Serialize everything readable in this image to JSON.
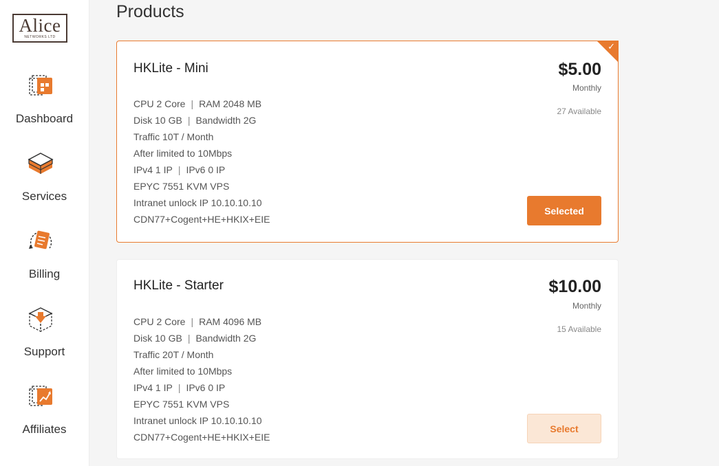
{
  "logo": {
    "name": "Alice",
    "subtitle": "NETWORKS LTD"
  },
  "nav": [
    {
      "label": "Dashboard",
      "icon": "dashboard-icon"
    },
    {
      "label": "Services",
      "icon": "services-icon"
    },
    {
      "label": "Billing",
      "icon": "billing-icon"
    },
    {
      "label": "Support",
      "icon": "support-icon"
    },
    {
      "label": "Affiliates",
      "icon": "affiliates-icon"
    }
  ],
  "page": {
    "title": "Products"
  },
  "products": [
    {
      "name": "HKLite - Mini",
      "price": "$5.00",
      "period": "Monthly",
      "available": "27 Available",
      "button": "Selected",
      "selected": true,
      "specs": [
        [
          "CPU 2 Core",
          "RAM 2048 MB"
        ],
        [
          "Disk 10 GB",
          "Bandwidth 2G"
        ],
        [
          "Traffic 10T / Month"
        ],
        [
          "After limited to 10Mbps"
        ],
        [
          "IPv4 1 IP",
          "IPv6 0 IP"
        ],
        [
          "EPYC 7551 KVM VPS"
        ],
        [
          "Intranet unlock IP 10.10.10.10"
        ],
        [
          "CDN77+Cogent+HE+HKIX+EIE"
        ]
      ]
    },
    {
      "name": "HKLite - Starter",
      "price": "$10.00",
      "period": "Monthly",
      "available": "15 Available",
      "button": "Select",
      "selected": false,
      "specs": [
        [
          "CPU 2 Core",
          "RAM 4096 MB"
        ],
        [
          "Disk 10 GB",
          "Bandwidth 2G"
        ],
        [
          "Traffic 20T / Month"
        ],
        [
          "After limited to 10Mbps"
        ],
        [
          "IPv4 1 IP",
          "IPv6 0 IP"
        ],
        [
          "EPYC 7551 KVM VPS"
        ],
        [
          "Intranet unlock IP 10.10.10.10"
        ],
        [
          "CDN77+Cogent+HE+HKIX+EIE"
        ]
      ]
    }
  ],
  "colors": {
    "accent": "#e87a2e",
    "accent_light": "#fbe7d6",
    "text": "#333333",
    "background": "#f5f5f5"
  }
}
